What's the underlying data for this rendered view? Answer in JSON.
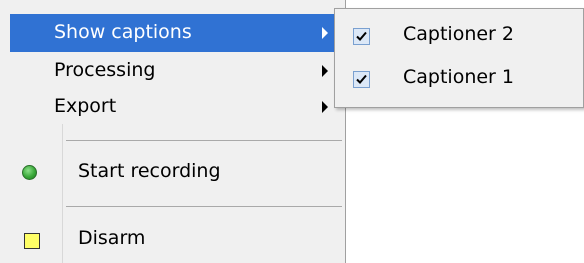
{
  "menu": {
    "items": [
      {
        "label": "Show captions",
        "submenu": true,
        "highlighted": true
      },
      {
        "label": "Processing",
        "submenu": true
      },
      {
        "label": "Export",
        "submenu": true
      },
      {
        "label": "Start recording",
        "icon": "green-circle-icon"
      },
      {
        "label": "Disarm",
        "icon": "yellow-square-icon"
      }
    ]
  },
  "submenu": {
    "items": [
      {
        "label": "Captioner 2",
        "checked": true
      },
      {
        "label": "Captioner 1",
        "checked": true
      }
    ]
  },
  "colors": {
    "highlight": "#3072d3",
    "menu_bg": "#f0f0f0",
    "record_icon": "#3aa93a",
    "disarm_icon": "#ffff66"
  }
}
